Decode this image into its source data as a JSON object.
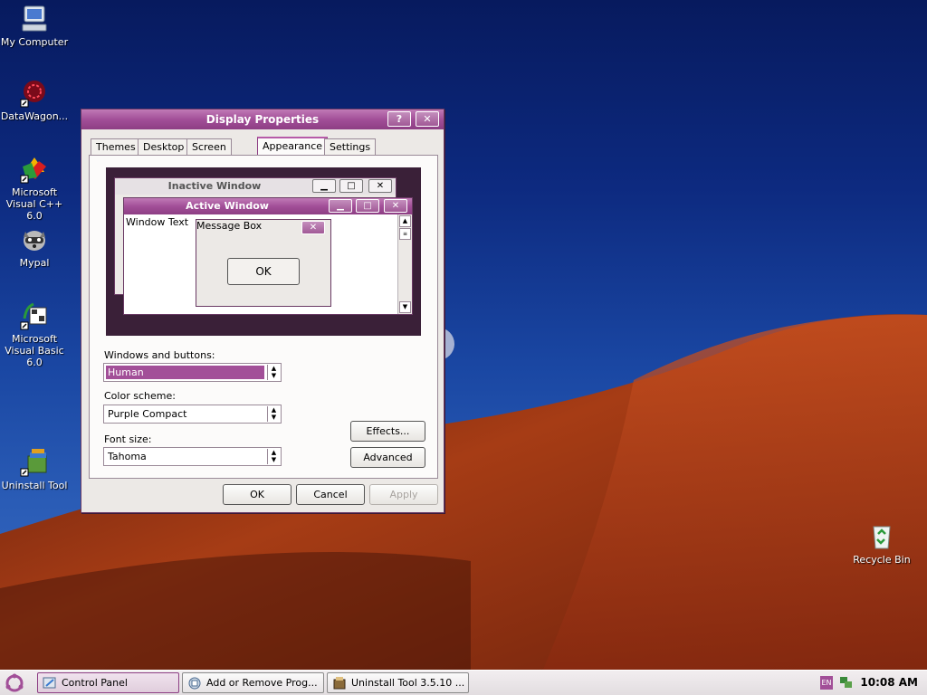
{
  "desktop": {
    "icons": [
      {
        "label": "My Computer"
      },
      {
        "label": "DataWagon..."
      },
      {
        "label": "Microsoft Visual C++ 6.0"
      },
      {
        "label": "Mypal"
      },
      {
        "label": "Microsoft Visual Basic 6.0"
      },
      {
        "label": "Uninstall Tool"
      },
      {
        "label": "Recycle Bin"
      }
    ]
  },
  "dialog": {
    "title": "Display Properties",
    "help_label": "?",
    "close_label": "✕",
    "tabs": [
      "Themes",
      "Desktop",
      "Screen Saver",
      "Appearance",
      "Settings"
    ],
    "active_tab": "Appearance",
    "preview": {
      "inactive_title": "Inactive Window",
      "active_title": "Active Window",
      "window_text": "Window Text",
      "message_title": "Message Box",
      "message_ok": "OK"
    },
    "windows_buttons": {
      "label": "Windows and buttons:",
      "value": "Human"
    },
    "color_scheme": {
      "label": "Color scheme:",
      "value": "Purple Compact"
    },
    "font_size": {
      "label": "Font size:",
      "value": "Tahoma"
    },
    "effects_label": "Effects...",
    "advanced_label": "Advanced",
    "ok_label": "OK",
    "cancel_label": "Cancel",
    "apply_label": "Apply"
  },
  "taskbar": {
    "tasks": [
      {
        "label": "Control Panel"
      },
      {
        "label": "Add or Remove Prog..."
      },
      {
        "label": "Uninstall Tool 3.5.10 ..."
      }
    ],
    "lang": "EN",
    "clock": "10:08 AM"
  },
  "colors": {
    "accent": "#a24f98",
    "sky": "#0d2a80",
    "dune": "#a63c15"
  }
}
